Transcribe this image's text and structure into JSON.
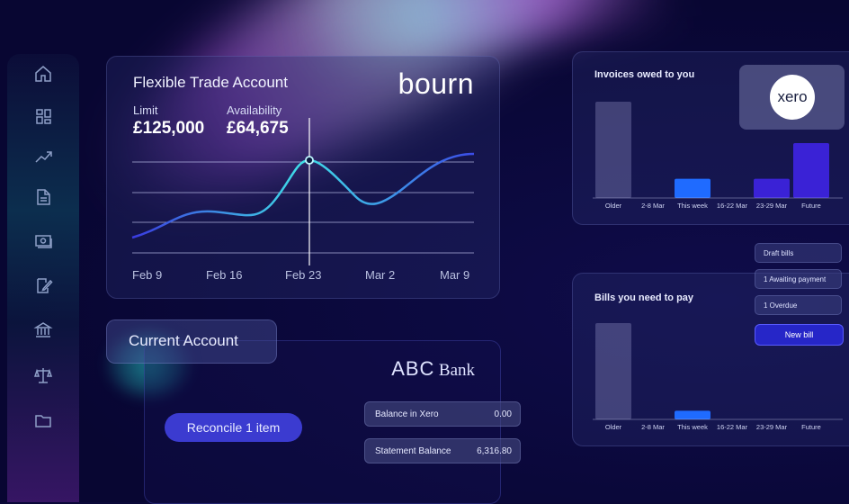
{
  "sidebar": {
    "icons": [
      "home-icon",
      "dashboard-icon",
      "trend-icon",
      "document-icon",
      "payments-icon",
      "edit-document-icon",
      "bank-icon",
      "scales-icon",
      "folder-icon"
    ]
  },
  "trade": {
    "title": "Flexible Trade Account",
    "logo": "bourn",
    "limit_label": "Limit",
    "limit_value": "£125,000",
    "availability_label": "Availability",
    "availability_value": "£64,675",
    "x_labels": [
      "Feb 9",
      "Feb 16",
      "Feb 23",
      "Mar 2",
      "Mar 9"
    ],
    "highlight_label": "Feb 23"
  },
  "current_account": {
    "title": "Current Account",
    "bank_name_a": "ABC",
    "bank_name_b": "Bank",
    "reconcile_label": "Reconcile 1 item",
    "balance_in_xero_label": "Balance in Xero",
    "balance_in_xero_value": "0.00",
    "statement_balance_label": "Statement Balance",
    "statement_balance_value": "6,316.80"
  },
  "invoices": {
    "title": "Invoices owed to you",
    "logo": "xero",
    "categories": [
      "Older",
      "2-8 Mar",
      "This week",
      "16-22 Mar",
      "23-29 Mar",
      "Future"
    ],
    "values": [
      100,
      0,
      20,
      0,
      20,
      57
    ]
  },
  "bills": {
    "title": "Bills you need to pay",
    "categories": [
      "Older",
      "2-8 Mar",
      "This week",
      "16-22 Mar",
      "23-29 Mar",
      "Future"
    ],
    "values": [
      100,
      0,
      9,
      0,
      0,
      0
    ],
    "pills": [
      "Draft bills",
      "1 Awaiting payment",
      "1 Overdue"
    ],
    "new_bill_label": "New bill"
  },
  "colors": {
    "accent": "#3b3bd0",
    "bar_blue": "#1f6bff",
    "bar_indigo": "#3a22d6",
    "background": "#0a0838"
  }
}
